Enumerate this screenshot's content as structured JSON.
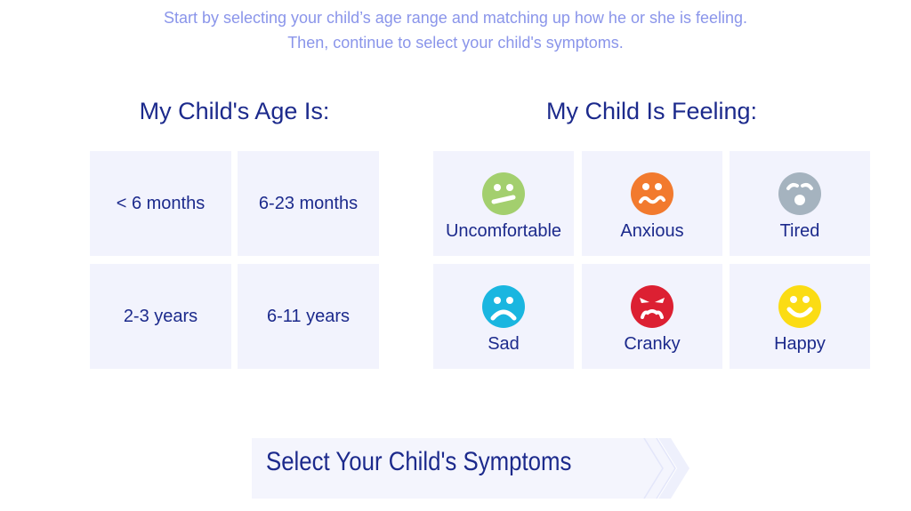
{
  "intro": {
    "line1": "Start by selecting your child’s age range and matching up how he or she is feeling.",
    "line2": "Then, continue to select your child's symptoms."
  },
  "age": {
    "heading": "My Child's Age Is:",
    "options": [
      {
        "label": "< 6 months"
      },
      {
        "label": "6-23 months"
      },
      {
        "label": "2-3 years"
      },
      {
        "label": "6-11 years"
      }
    ]
  },
  "feeling": {
    "heading": "My Child Is Feeling:",
    "options": [
      {
        "label": "Uncomfortable",
        "icon": "uncomfortable-face-icon",
        "color": "#a3cf6e"
      },
      {
        "label": "Anxious",
        "icon": "anxious-face-icon",
        "color": "#f27a2e"
      },
      {
        "label": "Tired",
        "icon": "tired-face-icon",
        "color": "#a5b3bf"
      },
      {
        "label": "Sad",
        "icon": "sad-face-icon",
        "color": "#1ab6e0"
      },
      {
        "label": "Cranky",
        "icon": "cranky-face-icon",
        "color": "#dc2032"
      },
      {
        "label": "Happy",
        "icon": "happy-face-icon",
        "color": "#fbdc14"
      }
    ]
  },
  "cta": {
    "label": "Select Your Child's Symptoms"
  }
}
